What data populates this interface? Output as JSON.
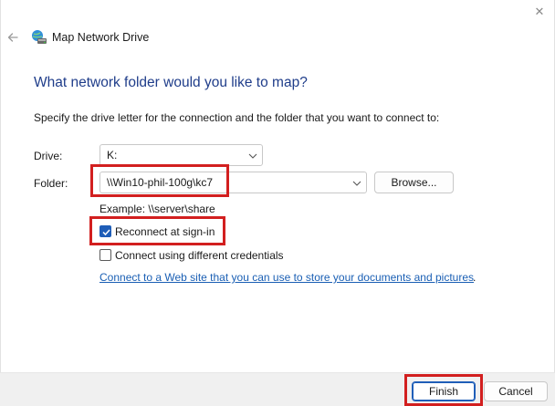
{
  "window": {
    "title": "Map Network Drive",
    "close_glyph": "✕",
    "icons": {
      "back": "back-arrow-icon",
      "app": "network-drive-icon",
      "close": "close-icon"
    }
  },
  "main": {
    "heading": "What network folder would you like to map?",
    "description": "Specify the drive letter for the connection and the folder that you want to connect to:",
    "drive": {
      "label": "Drive:",
      "value": "K:"
    },
    "folder": {
      "label": "Folder:",
      "value": "\\\\Win10-phil-100g\\kc7",
      "browse_label": "Browse..."
    },
    "example": "Example: \\\\server\\share",
    "reconnect": {
      "label": "Reconnect at sign-in",
      "checked": true
    },
    "credentials": {
      "label": "Connect using different credentials",
      "checked": false
    },
    "link": {
      "text": "Connect to a Web site that you can use to store your documents and pictures",
      "suffix": "."
    }
  },
  "footer": {
    "finish_label": "Finish",
    "cancel_label": "Cancel"
  },
  "colors": {
    "heading": "#1f3d8a",
    "link": "#1a5fb4",
    "accent": "#1f5eb8",
    "highlight": "#d21f1f"
  }
}
